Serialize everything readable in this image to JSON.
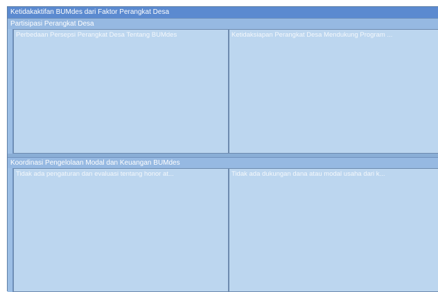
{
  "root": {
    "title": "Ketidakaktifan BUMdes dari Faktor Perangkat Desa"
  },
  "groups": [
    {
      "title": "Partisipasi Perangkat Desa",
      "tiles": [
        "Perbedaan Persepsi Perangkat Desa Tentang BUMdes",
        "Ketidaksiapan Perangkat Desa Mendukung Program ..."
      ]
    },
    {
      "title": "Koordinasi Pengelolaan Modal dan Keuangan BUMdes",
      "tiles": [
        "Tidak ada pengaturan dan evaluasi tentang honor at...",
        "Tidak ada dukungan dana atau modal usaha dari k..."
      ]
    }
  ],
  "colors": {
    "header": "#5b8ad0",
    "group_header": "#96b9e2",
    "tile": "#bcd6ef",
    "border": "#6d8aae"
  }
}
